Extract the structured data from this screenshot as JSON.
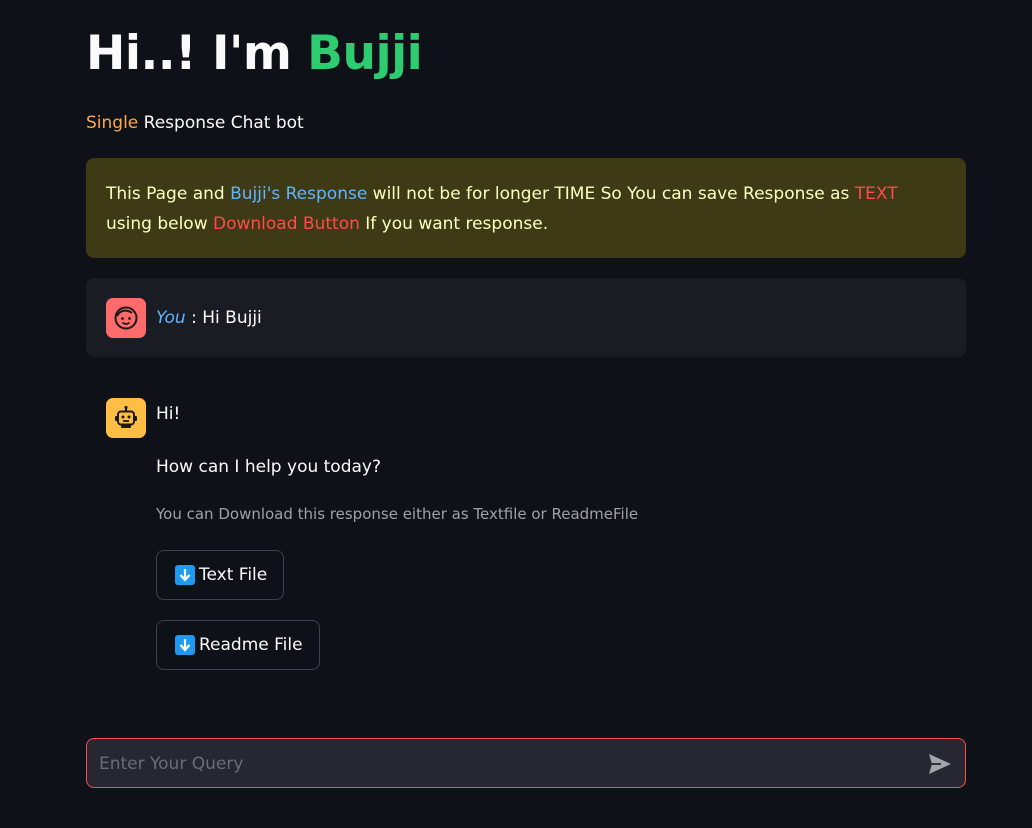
{
  "header": {
    "title_prefix": "Hi..! I'm ",
    "title_name": "Bujji",
    "subtitle_accent": "Single",
    "subtitle_rest": " Response Chat bot"
  },
  "notice": {
    "part1": "This Page and ",
    "part2": "Bujji's Response",
    "part3": " will not be for longer TIME So You can save Response as ",
    "part4": "TEXT",
    "part5": " using below ",
    "part6": "Download Button",
    "part7": " If you want response."
  },
  "user_message": {
    "author": "You",
    "separator": " : ",
    "text": "Hi Bujji",
    "avatar_icon": "smiley-face-icon"
  },
  "bot_message": {
    "avatar_icon": "robot-icon",
    "line1": "Hi!",
    "line2": "How can I help you today?",
    "caption": "You can Download this response either as Textfile or ReadmeFile"
  },
  "downloads": {
    "text_file_label": "Text File",
    "readme_file_label": "Readme File",
    "icon": "down-arrow-icon"
  },
  "chat_input": {
    "placeholder": "Enter Your Query",
    "send_icon": "send-icon"
  },
  "colors": {
    "background": "#0e1117",
    "accent_green": "#2ecc71",
    "accent_orange": "#ffa94d",
    "link_blue": "#60b4ff",
    "alert_red": "#ff4b4b",
    "warning_bg": "#3d3a15"
  }
}
